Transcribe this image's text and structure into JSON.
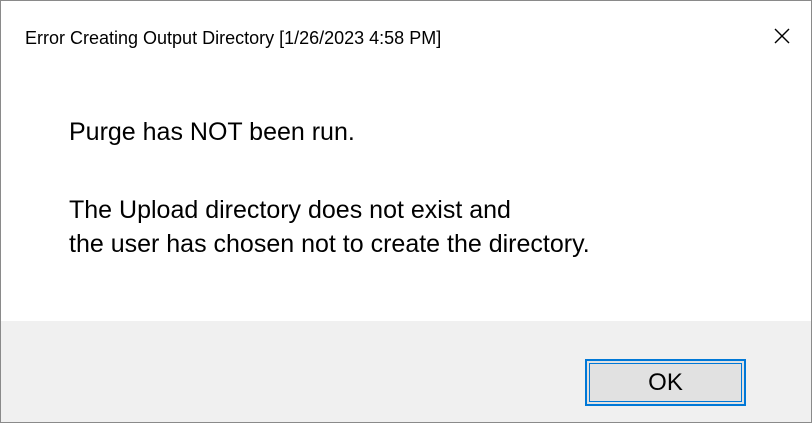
{
  "window": {
    "title": "Error Creating Output Directory [1/26/2023 4:58 PM]",
    "close_icon": "close-icon"
  },
  "message": {
    "line1": "Purge has NOT been run.",
    "line2": "The Upload directory does not exist and",
    "line3": "the user has chosen not to create the directory."
  },
  "footer": {
    "ok_label": "OK"
  },
  "colors": {
    "footer_bg": "#f0f0f0",
    "button_bg": "#e1e1e1",
    "button_focus_border": "#0078d7"
  }
}
